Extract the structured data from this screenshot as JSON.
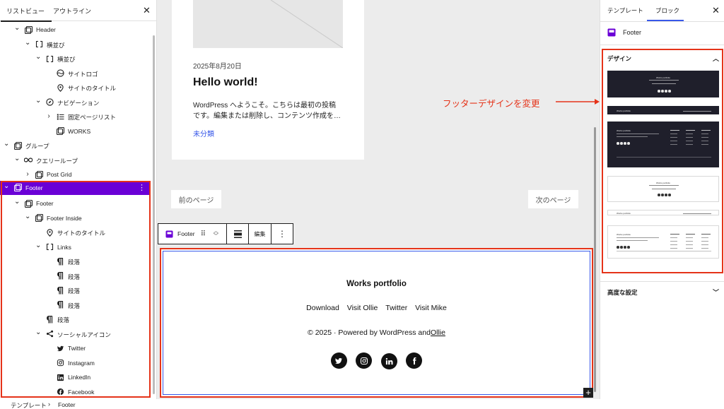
{
  "left_panel": {
    "tabs": [
      "リストビュー",
      "アウトライン"
    ],
    "tree": [
      {
        "label": "Header",
        "icon": "template-part-icon",
        "chev": "down"
      },
      {
        "label": "横並び",
        "icon": "row-icon",
        "chev": "down"
      },
      {
        "label": "横並び",
        "icon": "row-icon",
        "chev": "down"
      },
      {
        "label": "サイトロゴ",
        "icon": "site-logo-icon",
        "chev": ""
      },
      {
        "label": "サイトのタイトル",
        "icon": "map-pin-icon",
        "chev": ""
      },
      {
        "label": "ナビゲーション",
        "icon": "compass-icon",
        "chev": "down"
      },
      {
        "label": "固定ページリスト",
        "icon": "page-list-icon",
        "chev": "right"
      },
      {
        "label": "WORKS",
        "icon": "template-part-icon",
        "chev": ""
      },
      {
        "label": "グループ",
        "icon": "group-icon",
        "chev": "down"
      },
      {
        "label": "クエリーループ",
        "icon": "loop-icon",
        "chev": "down"
      },
      {
        "label": "Post Grid",
        "icon": "group-icon",
        "chev": "right"
      },
      {
        "label": "Footer",
        "icon": "template-part-icon",
        "chev": "down",
        "selected": true
      },
      {
        "label": "Footer",
        "icon": "group-icon",
        "chev": "down"
      },
      {
        "label": "Footer Inside",
        "icon": "group-icon",
        "chev": "down"
      },
      {
        "label": "サイトのタイトル",
        "icon": "map-pin-icon",
        "chev": ""
      },
      {
        "label": "Links",
        "icon": "row-icon",
        "chev": "down"
      },
      {
        "label": "段落",
        "icon": "paragraph-icon",
        "chev": ""
      },
      {
        "label": "段落",
        "icon": "paragraph-icon",
        "chev": ""
      },
      {
        "label": "段落",
        "icon": "paragraph-icon",
        "chev": ""
      },
      {
        "label": "段落",
        "icon": "paragraph-icon",
        "chev": ""
      },
      {
        "label": "段落",
        "icon": "paragraph-icon",
        "chev": ""
      },
      {
        "label": "ソーシャルアイコン",
        "icon": "share-icon",
        "chev": "down"
      },
      {
        "label": "Twitter",
        "icon": "twitter-icon",
        "chev": ""
      },
      {
        "label": "Instagram",
        "icon": "instagram-icon",
        "chev": ""
      },
      {
        "label": "LinkedIn",
        "icon": "linkedin-icon",
        "chev": ""
      },
      {
        "label": "Facebook",
        "icon": "facebook-icon",
        "chev": ""
      }
    ]
  },
  "canvas": {
    "post": {
      "date": "2025年8月20日",
      "title": "Hello world!",
      "excerpt_1": "WordPress へようこそ。こちらは最初の投稿",
      "excerpt_2": "です。編集または削除し、コンテンツ作成を…",
      "category": "未分類"
    },
    "pagination": {
      "prev": "前のページ",
      "next": "次のページ"
    },
    "toolbar": {
      "block_name": "Footer",
      "edit_label": "編集"
    },
    "footer": {
      "site_title": "Works portfolio",
      "links": [
        "Download",
        "Visit Ollie",
        "Twitter",
        "Visit Mike"
      ],
      "copyright_prefix": "© 2025 · Powered by WordPress and",
      "copyright_link": "Ollie",
      "social_icons": [
        "twitter-icon",
        "instagram-icon",
        "linkedin-icon",
        "facebook-icon"
      ]
    }
  },
  "right_panel": {
    "tabs": [
      "テンプレート",
      "ブロック"
    ],
    "active_tab": "ブロック",
    "block_name": "Footer",
    "design_section": "デザイン",
    "advanced_section": "高度な設定",
    "annotation": "フッターデザインを変更",
    "patterns": [
      {
        "theme": "dark",
        "title": "Works portfolio"
      },
      {
        "theme": "dark",
        "title": "Works portfolio"
      },
      {
        "theme": "dark",
        "title": "Works portfolio"
      },
      {
        "theme": "light",
        "title": "Works portfolio"
      },
      {
        "theme": "light",
        "title": "Works portfolio"
      },
      {
        "theme": "light",
        "title": "Works portfolio"
      }
    ]
  },
  "breadcrumb": [
    "テンプレート",
    "Footer"
  ],
  "colors": {
    "accent": "#6a00d6",
    "annotation": "#e53319",
    "link": "#3858e9"
  }
}
